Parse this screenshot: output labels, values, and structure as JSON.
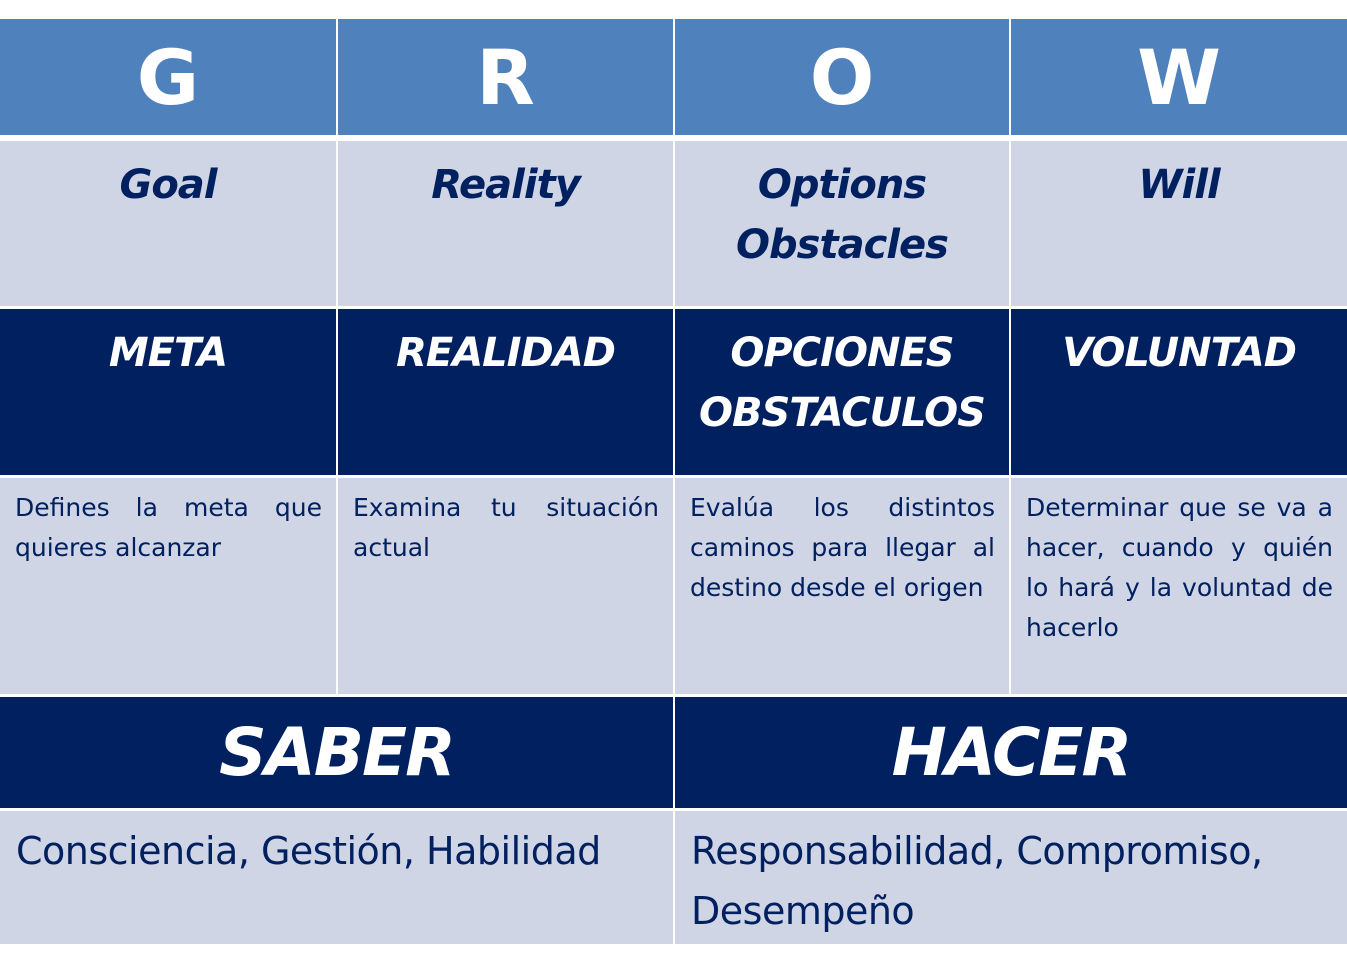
{
  "title": "GROW",
  "colors": {
    "header_blue": "#4F81BD",
    "navy": "#002060",
    "light_cell": "#CFD5E5",
    "white": "#FFFFFF"
  },
  "columns": [
    {
      "letter": "G",
      "english": [
        "Goal"
      ],
      "spanish": [
        "META"
      ],
      "description": "Defines la meta que quieres alcanzar"
    },
    {
      "letter": "R",
      "english": [
        "Reality"
      ],
      "spanish": [
        "REALIDAD"
      ],
      "description": "Examina tu situación actual"
    },
    {
      "letter": "O",
      "english": [
        "Options",
        "Obstacles"
      ],
      "spanish": [
        "OPCIONES",
        "OBSTACULOS"
      ],
      "description": "Evalúa los distintos caminos para llegar al destino desde el origen"
    },
    {
      "letter": "W",
      "english": [
        "Will"
      ],
      "spanish": [
        "VOLUNTAD"
      ],
      "description": "Determinar que se va a hacer, cuando y quién lo hará y la voluntad de hacerlo"
    }
  ],
  "groups": [
    {
      "title": "SABER",
      "items": "Consciencia, Gestión, Habilidad"
    },
    {
      "title": "HACER",
      "items": "Responsabilidad, Compromiso, Desempeño"
    }
  ]
}
